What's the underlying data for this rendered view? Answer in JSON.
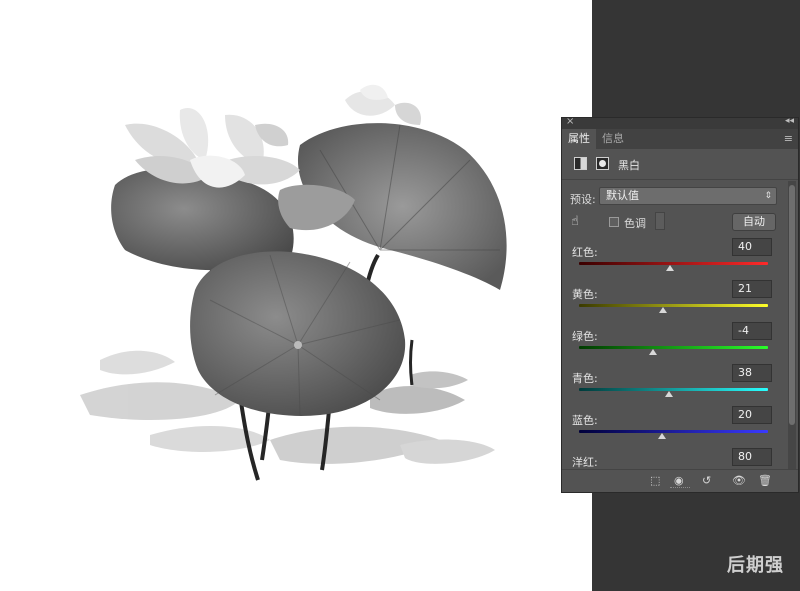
{
  "panel": {
    "tabs": [
      {
        "label": "属性",
        "active": true
      },
      {
        "label": "信息",
        "active": false
      }
    ],
    "close_label": "×",
    "collapse_label": "◂◂",
    "menu_icon": "≡",
    "adjustment_title": "黑白",
    "preset": {
      "label": "预设:",
      "value": "默认值"
    },
    "tint": {
      "label": "色调",
      "checked": false
    },
    "auto_label": "自动",
    "sliders": [
      {
        "label": "红色:",
        "value": "40",
        "min": -200,
        "max": 300,
        "gradient": [
          "#3a0000",
          "#ff2a2a"
        ]
      },
      {
        "label": "黄色:",
        "value": "21",
        "min": -200,
        "max": 300,
        "gradient": [
          "#3a3a00",
          "#ffff2a"
        ]
      },
      {
        "label": "绿色:",
        "value": "-4",
        "min": -200,
        "max": 300,
        "gradient": [
          "#003a00",
          "#2aff2a"
        ]
      },
      {
        "label": "青色:",
        "value": "38",
        "min": -200,
        "max": 300,
        "gradient": [
          "#003a3a",
          "#2affff"
        ]
      },
      {
        "label": "蓝色:",
        "value": "20",
        "min": -200,
        "max": 300,
        "gradient": [
          "#00003a",
          "#3a3aff"
        ]
      },
      {
        "label": "洋红:",
        "value": "80",
        "min": -200,
        "max": 300,
        "gradient": [
          "#3a003a",
          "#ff2aff"
        ]
      }
    ],
    "footer_icons": [
      "clip-to-layer-icon",
      "view-previous-icon",
      "reset-icon",
      "visibility-eye-icon",
      "trash-icon"
    ]
  },
  "watermark": "后期强",
  "colors": {
    "panel_bg": "#535353",
    "workspace_bg": "#353535"
  }
}
